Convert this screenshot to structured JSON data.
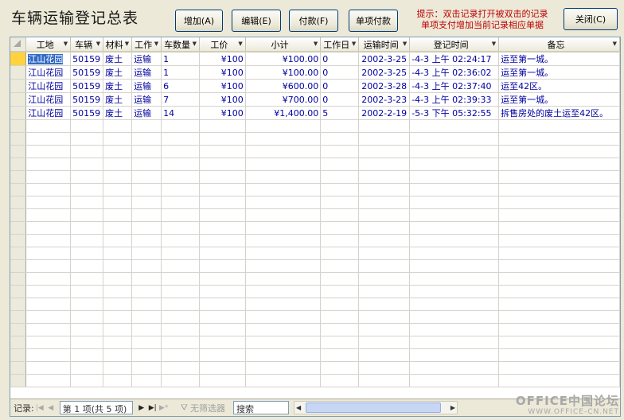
{
  "form": {
    "title": "车辆运输登记总表"
  },
  "toolbar": {
    "add_label": "增加(A)",
    "edit_label": "编辑(E)",
    "pay_label": "付款(F)",
    "single_pay_label": "单项付款",
    "close_label": "关闭(C)"
  },
  "hint": {
    "line1": "提示：双击记录打开被双击的记录",
    "line2": "单项支付增加当前记录相应单据"
  },
  "grid": {
    "columns": [
      "工地",
      "车辆",
      "材料",
      "工作",
      "车数量",
      "工价",
      "小计",
      "工作日",
      "运输时间",
      "登记时间",
      "备忘"
    ],
    "rows": [
      [
        "江山花园",
        "50159",
        "废土",
        "运输",
        "1",
        "¥100",
        "¥100.00",
        "0",
        "2002-3-25",
        "-4-3 上午 02:24:17",
        "运至第一城。"
      ],
      [
        "江山花园",
        "50159",
        "废土",
        "运输",
        "1",
        "¥100",
        "¥100.00",
        "0",
        "2002-3-25",
        "-4-3 上午 02:36:02",
        "运至第一城。"
      ],
      [
        "江山花园",
        "50159",
        "废土",
        "运输",
        "6",
        "¥100",
        "¥600.00",
        "0",
        "2002-3-28",
        "-4-3 上午 02:37:40",
        "运至42区。"
      ],
      [
        "江山花园",
        "50159",
        "废土",
        "运输",
        "7",
        "¥100",
        "¥700.00",
        "0",
        "2002-3-23",
        "-4-3 上午 02:39:33",
        "运至第一城。"
      ],
      [
        "江山花园",
        "50159",
        "废土",
        "运输",
        "14",
        "¥100",
        "¥1,400.00",
        "5",
        "2002-2-19",
        "-5-3 下午 05:32:55",
        "拆售房处的废土运至42区。"
      ]
    ]
  },
  "nav": {
    "record_label": "记录:",
    "record_position": "第 1 项(共 5 项)",
    "filter_label": "无筛选器",
    "search_placeholder": "搜索"
  },
  "watermark": {
    "line1": "OFFICE中国论坛",
    "line2": "WWW.OFFICE-CN.NET"
  }
}
